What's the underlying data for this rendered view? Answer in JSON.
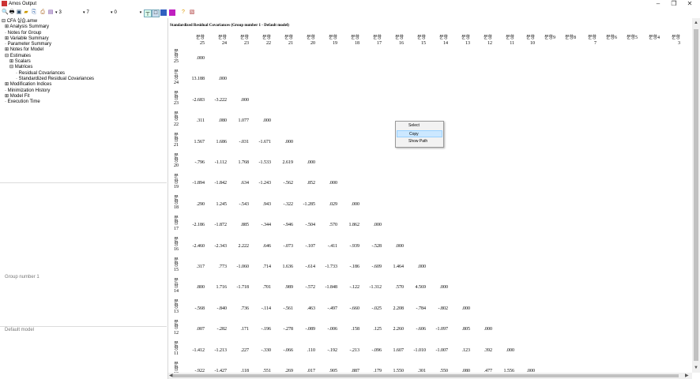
{
  "window": {
    "title": "Amos Output",
    "minimize": "–",
    "maximize": "❐",
    "close": "✕"
  },
  "toolbar": {
    "icons": [
      "preview-icon",
      "print-icon",
      "page-setup-icon",
      "open-icon",
      "options-icon",
      "copy-icon",
      "view-icon"
    ],
    "combo1": "3",
    "combo2": "7",
    "combo3": "0",
    "extra_icons": [
      "table-icon",
      "format1-icon",
      "format2-icon",
      "format3-icon",
      "help-icon",
      "output-icon"
    ]
  },
  "tree": [
    {
      "label": "CFA 실습.amw",
      "prefix": "⊟"
    },
    {
      "label": "Analysis Summary",
      "prefix": "⊞"
    },
    {
      "label": "Notes for Group",
      "prefix": "·"
    },
    {
      "label": "Variable Summary",
      "prefix": "⊞"
    },
    {
      "label": "Parameter Summary",
      "prefix": "·"
    },
    {
      "label": "Notes for Model",
      "prefix": "⊞"
    },
    {
      "label": "Estimates",
      "prefix": "⊟"
    },
    {
      "label": "Scalars",
      "prefix": "⊞"
    },
    {
      "label": "Matrices",
      "prefix": "⊟"
    },
    {
      "label": "Residual Covariances",
      "prefix": "·"
    },
    {
      "label": "Standardized Residual Covariances",
      "prefix": "·"
    },
    {
      "label": "Modification Indices",
      "prefix": "⊞"
    },
    {
      "label": "Minimization History",
      "prefix": "·"
    },
    {
      "label": "Model Fit",
      "prefix": "⊞"
    },
    {
      "label": "Execution Time",
      "prefix": "·"
    }
  ],
  "panes": {
    "group": "Group number 1",
    "model": "Default model"
  },
  "report": {
    "title": "Standardized Residual Covariances (Group number 1 - Default model)",
    "columns": [
      {
        "top": "문항",
        "bottom": "25"
      },
      {
        "top": "문항",
        "bottom": "24"
      },
      {
        "top": "문항",
        "bottom": "23"
      },
      {
        "top": "문항",
        "bottom": "22"
      },
      {
        "top": "문항",
        "bottom": "21"
      },
      {
        "top": "문항",
        "bottom": "20"
      },
      {
        "top": "문항",
        "bottom": "19"
      },
      {
        "top": "문항",
        "bottom": "18"
      },
      {
        "top": "문항",
        "bottom": "17"
      },
      {
        "top": "문항",
        "bottom": "16"
      },
      {
        "top": "문항",
        "bottom": "15"
      },
      {
        "top": "문항",
        "bottom": "14"
      },
      {
        "top": "문항",
        "bottom": "13"
      },
      {
        "top": "문항",
        "bottom": "12"
      },
      {
        "top": "문항",
        "bottom": "11"
      },
      {
        "top": "문항",
        "bottom": "10"
      },
      {
        "top": "문항9",
        "bottom": ""
      },
      {
        "top": "문항8",
        "bottom": ""
      },
      {
        "top": "문항",
        "bottom": "7"
      },
      {
        "top": "문항6",
        "bottom": ""
      },
      {
        "top": "문항5",
        "bottom": ""
      },
      {
        "top": "문항4",
        "bottom": ""
      },
      {
        "top": "문항",
        "bottom": "3"
      },
      {
        "top": "문항",
        "bottom": "2"
      }
    ],
    "rows": [
      {
        "label": "문항25",
        "values": [
          ".000"
        ]
      },
      {
        "label": "문항24",
        "values": [
          "13.188",
          ".000"
        ]
      },
      {
        "label": "문항23",
        "values": [
          "-2.683",
          "-3.222",
          ".000"
        ]
      },
      {
        "label": "문항22",
        "values": [
          ".311",
          ".080",
          "1.077",
          ".000"
        ]
      },
      {
        "label": "문항21",
        "values": [
          "1.567",
          "1.686",
          "-.031",
          "-1.671",
          ".000"
        ]
      },
      {
        "label": "문항20",
        "values": [
          "-.796",
          "-1.112",
          "1.768",
          "-1.533",
          "2.619",
          ".000"
        ]
      },
      {
        "label": "문항19",
        "values": [
          "-1.894",
          "-1.842",
          ".634",
          "-1.243",
          "-.562",
          ".852",
          ".000"
        ]
      },
      {
        "label": "문항18",
        "values": [
          ".290",
          "1.245",
          "-.543",
          ".943",
          "-.322",
          "-1.285",
          ".029",
          ".000"
        ]
      },
      {
        "label": "문항17",
        "values": [
          "-2.186",
          "-1.872",
          ".885",
          "-.344",
          "-.946",
          "-.504",
          ".570",
          "1.862",
          ".000"
        ]
      },
      {
        "label": "문항16",
        "values": [
          "-2.460",
          "-2.343",
          "2.222",
          ".646",
          "-.073",
          "-.107",
          "-.411",
          "-.939",
          "-.528",
          ".000"
        ]
      },
      {
        "label": "문항15",
        "values": [
          ".317",
          ".773",
          "-1.060",
          ".714",
          "1.636",
          "-.614",
          "-1.733",
          "-.186",
          "-.609",
          "1.464",
          ".000"
        ]
      },
      {
        "label": "문항14",
        "values": [
          ".800",
          "1.716",
          "-1.718",
          ".701",
          ".989",
          "-.572",
          "-1.848",
          "-.122",
          "-1.312",
          ".570",
          "4.569",
          ".000"
        ]
      },
      {
        "label": "문항13",
        "values": [
          "-.568",
          "-.840",
          ".736",
          "-.114",
          "-.561",
          ".463",
          "-.497",
          "-.660",
          "-.025",
          "2.208",
          "-.784",
          "-.802",
          ".000"
        ]
      },
      {
        "label": "문항12",
        "values": [
          ".007",
          "-.282",
          ".171",
          "-.196",
          "-.278",
          "-.089",
          "-.006",
          ".158",
          ".125",
          "2.260",
          "-.606",
          "-1.097",
          ".805",
          ".000"
        ]
      },
      {
        "label": "문항11",
        "values": [
          "-1.412",
          "-1.213",
          ".227",
          "-.330",
          "-.066",
          ".110",
          "-.192",
          "-.213",
          "-.096",
          "1.607",
          "-1.010",
          "-1.007",
          ".123",
          ".392",
          ".000"
        ]
      },
      {
        "label": "문항10",
        "values": [
          "-.922",
          "-1.427",
          ".118",
          ".551",
          ".269",
          ".017",
          ".905",
          ".887",
          ".179",
          "1.550",
          ".301",
          ".550",
          ".080",
          ".477",
          "1.556",
          ".000"
        ]
      }
    ]
  },
  "context_menu": {
    "items": [
      "Select",
      "Copy",
      "Show Path"
    ],
    "highlighted": "Copy"
  }
}
